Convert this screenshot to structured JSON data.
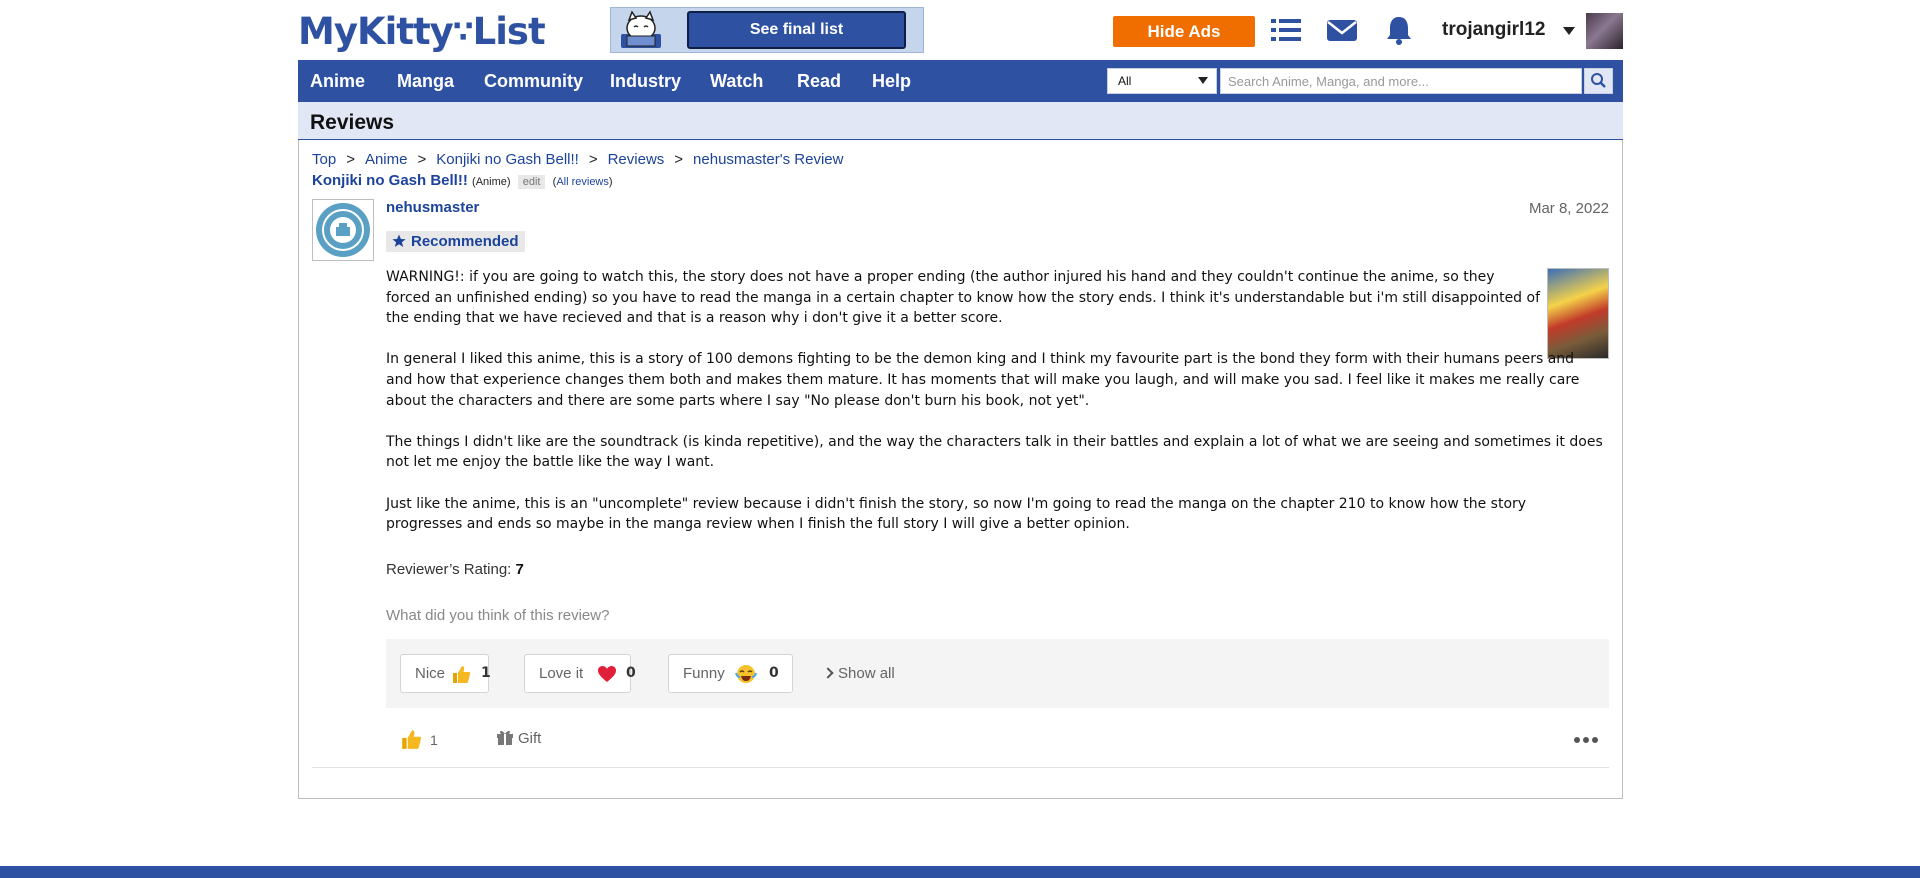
{
  "header": {
    "logo_text": "MyKitty",
    "logo_symbol": "∵",
    "logo_text2": "List",
    "promo_button": "See final list",
    "hide_ads": "Hide Ads",
    "username": "trojangirl12",
    "icons": [
      "list-icon",
      "mail-icon",
      "bell-icon",
      "caret-down-icon"
    ]
  },
  "nav": {
    "items": [
      "Anime",
      "Manga",
      "Community",
      "Industry",
      "Watch",
      "Read",
      "Help"
    ],
    "search_category": "All",
    "search_placeholder": "Search Anime, Manga, and more..."
  },
  "page": {
    "title": "Reviews",
    "breadcrumb": [
      "Top",
      "Anime",
      "Konjiki no Gash Bell!!",
      "Reviews",
      "nehusmaster's Review"
    ],
    "breadcrumb_sep": ">",
    "anime_title": "Konjiki no Gash Bell!!",
    "anime_type": "(Anime)",
    "edit": "edit",
    "all_reviews_open": "(",
    "all_reviews": "All reviews",
    "all_reviews_close": ")"
  },
  "review": {
    "username": "nehusmaster",
    "date": "Mar 8, 2022",
    "tag": "Recommended",
    "paragraphs": [
      "WARNING!: if you are going to watch this, the story does not have a proper ending (the author injured his hand and they couldn't continue the anime, so they forced an unfinished ending) so you have to read the manga in a certain chapter to know how the story ends. I think it's understandable but i'm still disappointed of the ending that we have recieved and that is a reason why i don't give it a better score.",
      "In general I liked this anime, this is a story of 100 demons fighting to be the demon king and I think my favourite part is the bond they form with their humans peers and and how that experience changes them both and makes them mature. It has moments that will make you laugh, and will make you sad. I feel like it makes me really care about the characters and there are some parts where I say \"No please don't burn his book, not yet\".",
      "The things I didn't like are the soundtrack (is kinda repetitive), and the way the characters talk in their battles and explain a lot of what we are seeing and sometimes it does not let me enjoy the battle like the way I want.",
      "Just like the anime, this is an \"uncomplete\" review because i didn't finish the story, so now I'm going to read the manga on the chapter 210 to know how the story progresses and ends so maybe in the manga review when I finish the full story I will give a better opinion."
    ],
    "rating_label": "Reviewer’s Rating:",
    "rating_value": "7",
    "question": "What did you think of this review?",
    "reactions": [
      {
        "label": "Nice",
        "count": "1",
        "icon": "thumbs-up-icon"
      },
      {
        "label": "Love it",
        "count": "0",
        "icon": "heart-icon"
      },
      {
        "label": "Funny",
        "count": "0",
        "icon": "laughing-face-icon"
      }
    ],
    "show_all": "Show all",
    "like_count": "1",
    "gift": "Gift"
  },
  "colors": {
    "brand": "#2e51a2",
    "link": "#1c439b",
    "hide_ads": "#f06d00",
    "title_bar": "#e1e7f5",
    "love": "#e0203a",
    "thumb": "#f5b820"
  }
}
